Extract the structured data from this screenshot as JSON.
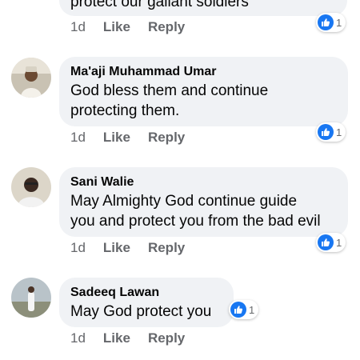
{
  "comments": [
    {
      "author": "",
      "text_line1": "protect our gallant soldiers",
      "time": "1d",
      "like": "Like",
      "reply": "Reply",
      "reactions": "1"
    },
    {
      "author": "Ma'aji Muhammad Umar",
      "text_line1": "God bless them and continue",
      "text_line2": "protecting them.",
      "time": "1d",
      "like": "Like",
      "reply": "Reply",
      "reactions": "1"
    },
    {
      "author": "Sani Walie",
      "text_line1": "May Almighty God continue guide",
      "text_line2": "you and protect you from the bad evil",
      "time": "1d",
      "like": "Like",
      "reply": "Reply",
      "reactions": "1"
    },
    {
      "author": "Sadeeq Lawan",
      "text_line1": "May God protect you",
      "time": "1d",
      "like": "Like",
      "reply": "Reply",
      "reactions": "1"
    }
  ],
  "colors": {
    "bubble": "#f0f2f5",
    "secondary_text": "#65676b",
    "like_blue": "#1877f2"
  },
  "icons": {
    "reaction": "like-thumbs-up-icon"
  }
}
